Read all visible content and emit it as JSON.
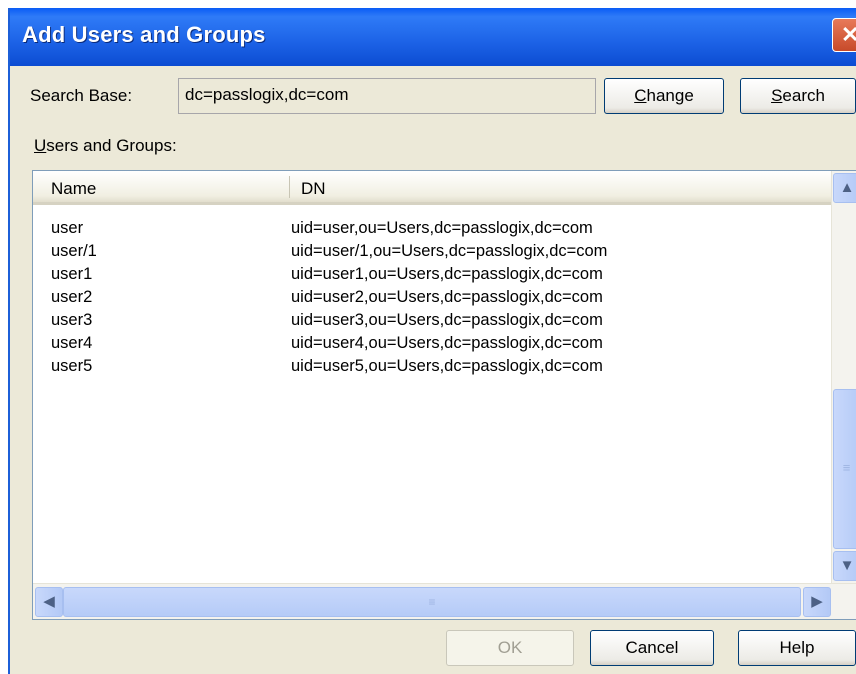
{
  "window": {
    "title": "Add Users and Groups",
    "close_glyph": "✕"
  },
  "search_base": {
    "label": "Search Base:",
    "value": "dc=passlogix,dc=com",
    "change_label_mnemonic": "C",
    "change_label_rest": "hange",
    "search_label_mnemonic": "S",
    "search_label_rest": "earch"
  },
  "users_groups": {
    "label_mnemonic": "U",
    "label_rest": "sers and Groups:",
    "columns": [
      "Name",
      "DN"
    ],
    "rows": [
      {
        "name": "user",
        "dn": "uid=user,ou=Users,dc=passlogix,dc=com"
      },
      {
        "name": "user/1",
        "dn": "uid=user/1,ou=Users,dc=passlogix,dc=com"
      },
      {
        "name": "user1",
        "dn": "uid=user1,ou=Users,dc=passlogix,dc=com"
      },
      {
        "name": "user2",
        "dn": "uid=user2,ou=Users,dc=passlogix,dc=com"
      },
      {
        "name": "user3",
        "dn": "uid=user3,ou=Users,dc=passlogix,dc=com"
      },
      {
        "name": "user4",
        "dn": "uid=user4,ou=Users,dc=passlogix,dc=com"
      },
      {
        "name": "user5",
        "dn": "uid=user5,ou=Users,dc=passlogix,dc=com"
      }
    ]
  },
  "scrollbar": {
    "up_icon": "up-arrow-icon",
    "up_glyph": "▲",
    "down_icon": "down-arrow-icon",
    "down_glyph": "▼",
    "left_icon": "left-arrow-icon",
    "left_glyph": "◀",
    "right_icon": "right-arrow-icon",
    "right_glyph": "▶",
    "grip_glyph": "≡"
  },
  "buttons": {
    "ok": "OK",
    "cancel": "Cancel",
    "help": "Help"
  },
  "colors": {
    "titlebar": "#1c62e6",
    "window_bg": "#ece9d8",
    "button_border": "#003c74"
  }
}
